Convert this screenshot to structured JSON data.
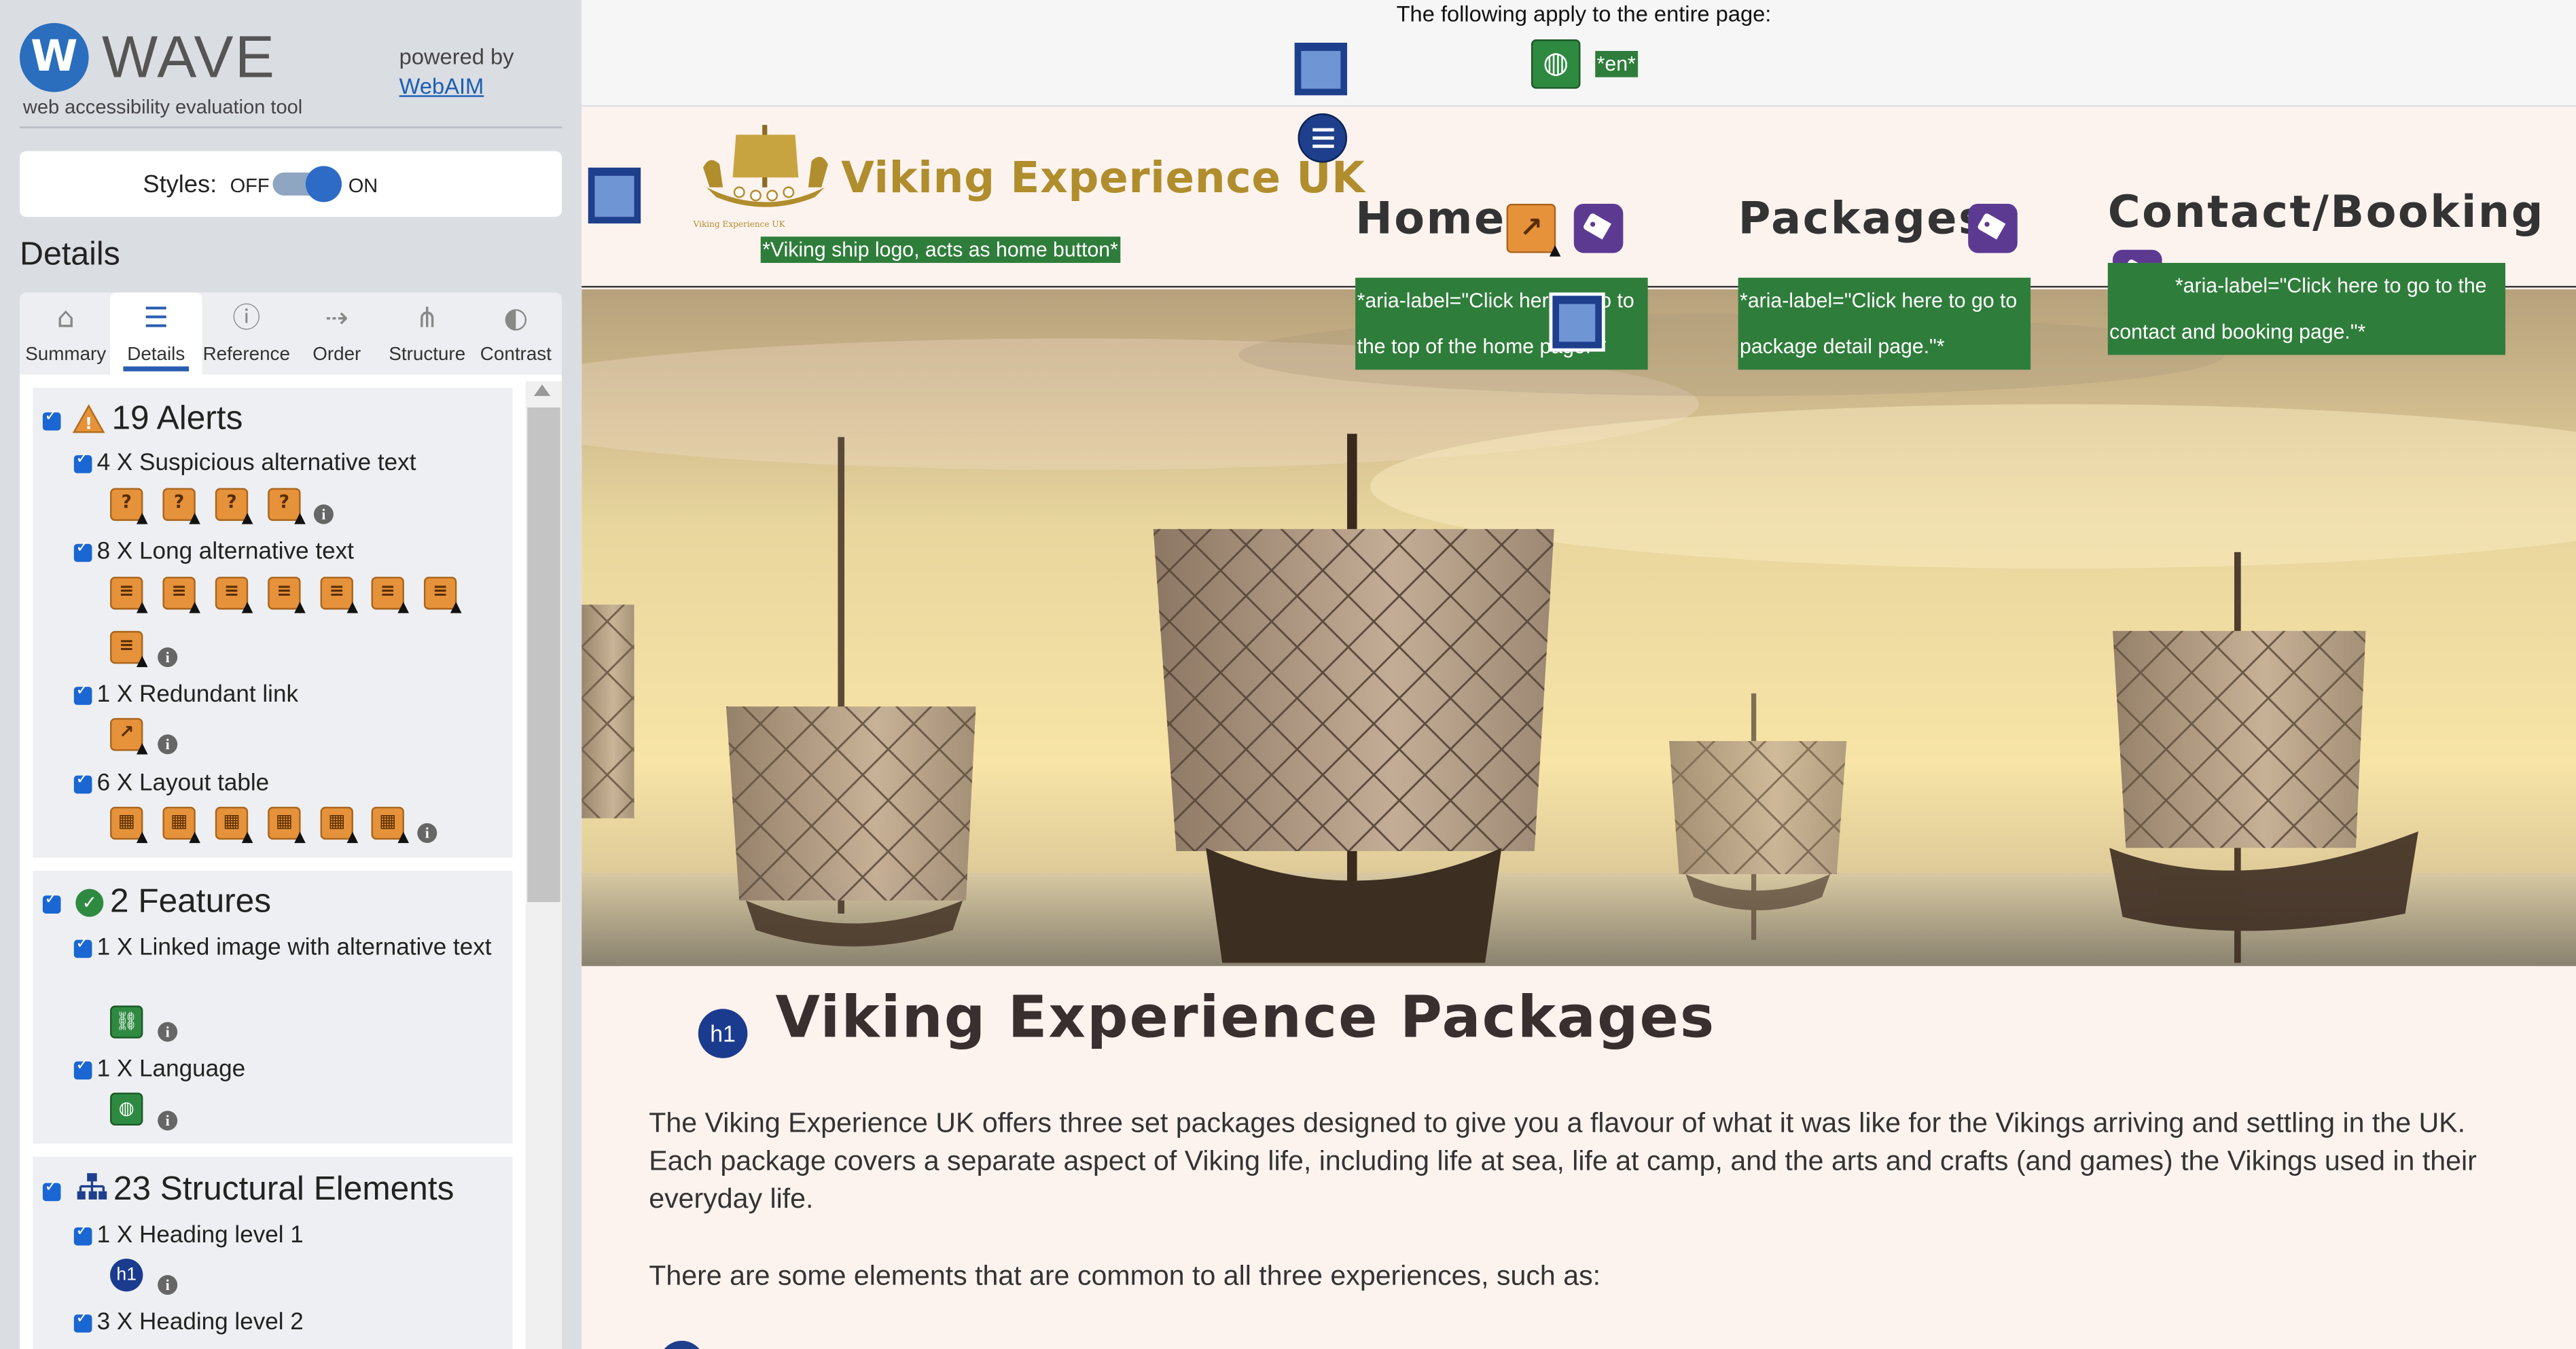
{
  "wave": {
    "logo_letter": "W",
    "name": "WAVE",
    "tagline": "web accessibility evaluation tool",
    "powered_by": "powered by",
    "webaim": "WebAIM",
    "styles_label": "Styles:",
    "styles_off": "OFF",
    "styles_on": "ON",
    "details_heading": "Details"
  },
  "tabs": [
    {
      "label": "Summary",
      "icon": "home-icon",
      "glyph": "⌂"
    },
    {
      "label": "Details",
      "icon": "list-icon",
      "glyph": "☰"
    },
    {
      "label": "Reference",
      "icon": "info-icon",
      "glyph": "ⓘ"
    },
    {
      "label": "Order",
      "icon": "order-icon",
      "glyph": "⇢"
    },
    {
      "label": "Structure",
      "icon": "structure-icon",
      "glyph": "⋔"
    },
    {
      "label": "Contrast",
      "icon": "contrast-icon",
      "glyph": "◐"
    }
  ],
  "alerts": {
    "title": "19 Alerts",
    "items": [
      {
        "label": "4 X Suspicious alternative text",
        "count": 4
      },
      {
        "label": "8 X Long alternative text",
        "count": 8
      },
      {
        "label": "1 X Redundant link",
        "count": 1
      },
      {
        "label": "6 X Layout table",
        "count": 6
      }
    ]
  },
  "features": {
    "title": "2 Features",
    "items": [
      {
        "label": "1 X Linked image with alternative text",
        "count": 1
      },
      {
        "label": "1 X Language",
        "count": 1
      }
    ]
  },
  "structural": {
    "title": "23 Structural Elements",
    "items": [
      {
        "label": "1 X Heading level 1",
        "count": 1
      },
      {
        "label": "3 X Heading level 2",
        "count": 3
      }
    ],
    "h1_icon_text": "h1"
  },
  "page": {
    "applies_text": "The following apply to the entire page:",
    "lang_label": "*en*",
    "site_name": "Viking Experience UK",
    "logo_alt": "*Viking ship logo, acts as home button*",
    "logo_small_text": "Viking Experience UK",
    "nav": [
      {
        "label": "Home",
        "aria": "*aria-label=\"Click here to go to the top of the home page.\"*"
      },
      {
        "label": "Packages",
        "aria": "*aria-label=\"Click here to go to package detail page.\"*"
      },
      {
        "label": "Contact/Booking",
        "aria": "*aria-label=\"Click here to go to the contact and booking page.\"*"
      }
    ],
    "h1": "Viking Experience Packages",
    "h1_badge": "h1",
    "para1": "The Viking Experience UK offers three set packages designed to give you a flavour of what it was like for the Vikings arriving and settling in the UK. Each package covers a separate aspect of Viking life, including life at sea, life at camp, and the arts and crafts (and games) the Vikings used in their everyday life.",
    "para2": "There are some elements that are common to all three experiences, such as:"
  },
  "colors": {
    "wave_blue": "#2a6ebd",
    "alert_orange": "#e5923b",
    "feature_green": "#2f8a41",
    "aria_green": "#2f7d3b",
    "tag_purple": "#5c3a92",
    "structure_blue": "#1e3f8c",
    "site_gold": "#b08d2d"
  }
}
